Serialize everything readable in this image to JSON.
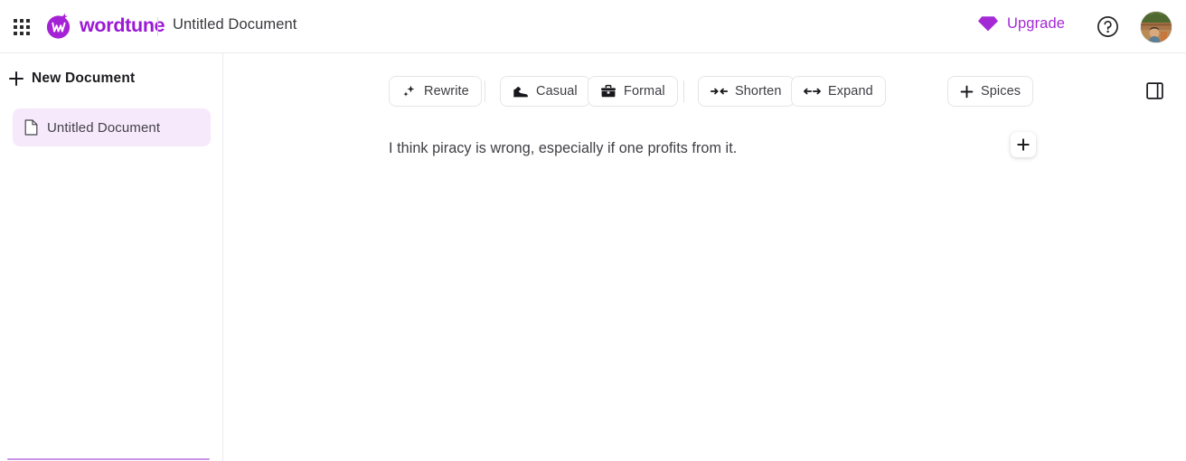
{
  "header": {
    "app_launcher_icon": "grid-dots-icon",
    "brand_name": "wordtune",
    "brand_logo_icon": "wordtune-logo-icon",
    "document_title": "Untitled Document",
    "upgrade_label": "Upgrade",
    "upgrade_icon": "diamond-icon",
    "help_icon": "question-circle-icon",
    "avatar_icon": "user-avatar",
    "accent_color": "#9b18d6",
    "upgrade_color": "#a42ad6"
  },
  "sidebar": {
    "new_document_label": "New Document",
    "new_document_icon": "plus-icon",
    "collapse_icon": "chevron-double-left-icon",
    "documents": [
      {
        "label": "Untitled Document",
        "icon": "document-icon",
        "selected": true
      }
    ],
    "selected_bg": "#f6e9fb",
    "bottom_rule_color": "#cb93e6"
  },
  "toolbar": {
    "buttons": [
      {
        "label": "Rewrite",
        "icon": "sparkles-icon"
      },
      {
        "label": "Casual",
        "icon": "sneaker-icon"
      },
      {
        "label": "Formal",
        "icon": "briefcase-icon"
      },
      {
        "label": "Shorten",
        "icon": "arrows-inward-icon"
      },
      {
        "label": "Expand",
        "icon": "arrows-outward-icon"
      },
      {
        "label": "Spices",
        "icon": "plus-icon"
      }
    ],
    "panel_toggle_icon": "right-panel-toggle-icon"
  },
  "editor": {
    "paragraph": "I think piracy is wrong, especially if one profits from it.",
    "add_block_icon": "plus-icon"
  }
}
